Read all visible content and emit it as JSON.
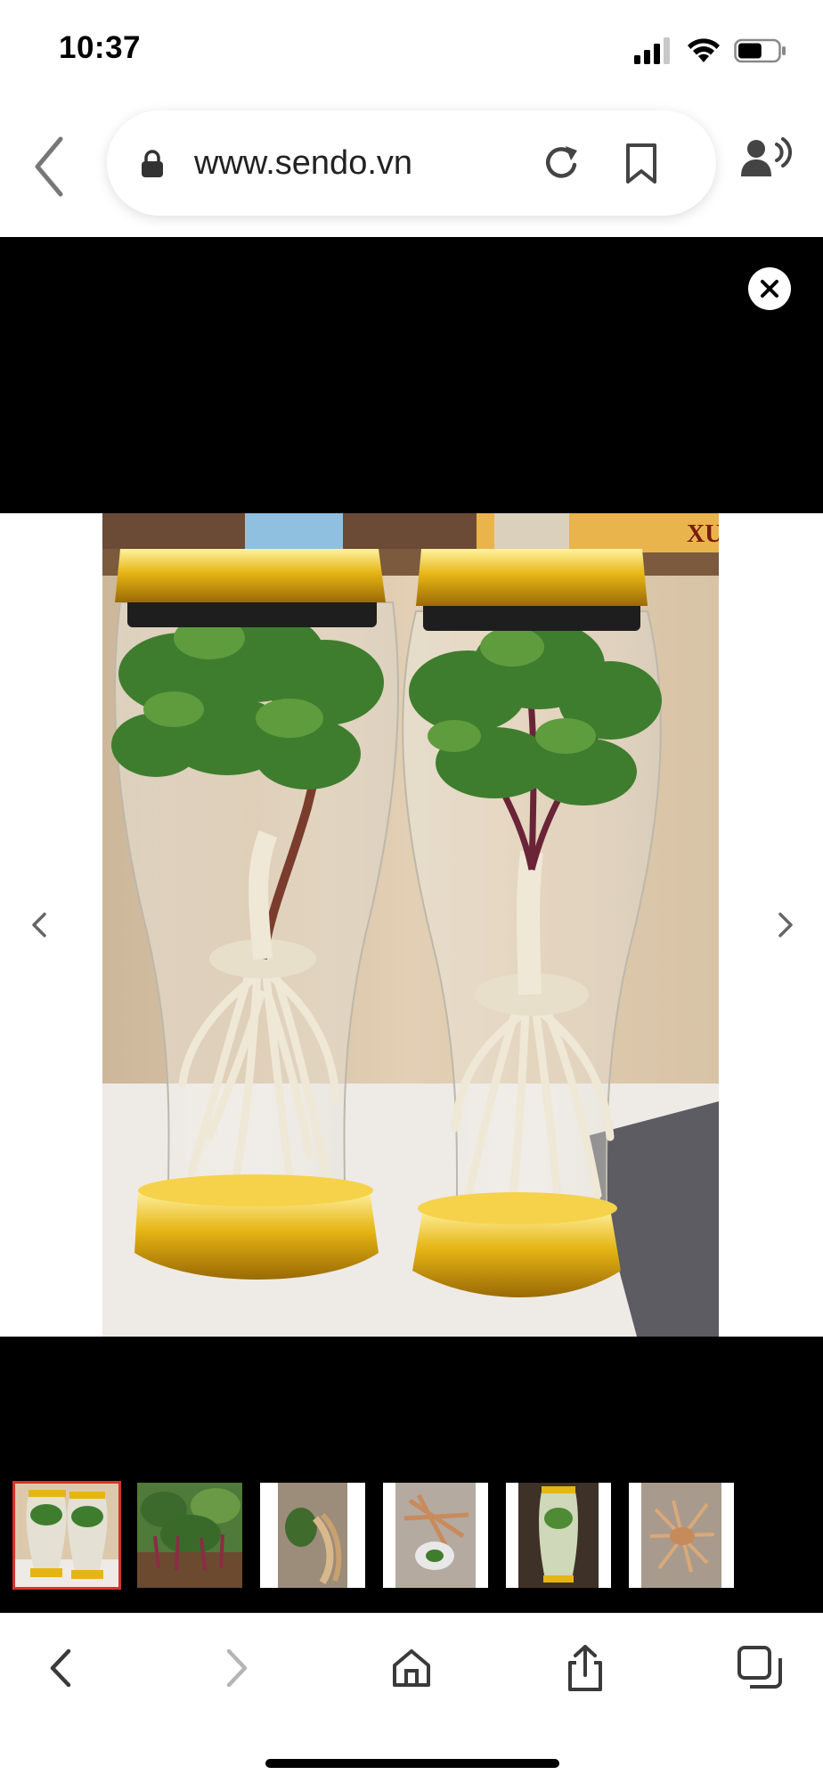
{
  "status_bar": {
    "time": "10:37",
    "battery_level": 0.6
  },
  "browser": {
    "url": "www.sendo.vn"
  },
  "icons": {
    "back": "chevron-left-icon",
    "lock": "lock-icon",
    "reload": "reload-icon",
    "bookmark": "bookmark-icon",
    "listen": "speaker-person-icon",
    "close": "close-icon",
    "prev": "chevron-left-icon",
    "next": "chevron-right-icon",
    "home": "home-icon",
    "share": "share-icon",
    "tabs": "tabs-icon"
  },
  "viewer": {
    "thumbnail_count": 6,
    "selected_thumbnail": 1,
    "photo_label": "XU"
  },
  "colors": {
    "accent_selected": "#d9312b",
    "viewer_background": "#000000",
    "disabled": "#b5b5b5"
  }
}
